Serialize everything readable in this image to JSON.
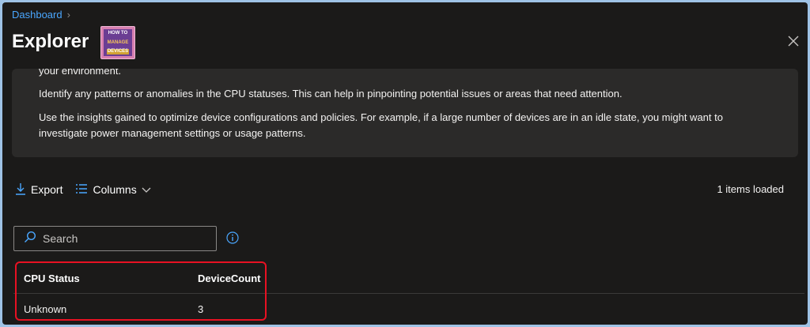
{
  "breadcrumb": {
    "root": "Dashboard",
    "separator": "›"
  },
  "page_title": "Explorer",
  "logo": {
    "line1": "HOW TO",
    "line2": "MANAGE",
    "line3": "DEVICES"
  },
  "info": {
    "cut_line": "your environment.",
    "p1": "Identify any patterns or anomalies in the CPU statuses. This can help in pinpointing potential issues or areas that need attention.",
    "p2": "Use the insights gained to optimize device configurations and policies. For example, if a large number of devices are in an idle state, you might want to investigate power management settings or usage patterns."
  },
  "toolbar": {
    "export_label": "Export",
    "columns_label": "Columns"
  },
  "status": {
    "items_loaded": "1 items loaded"
  },
  "search": {
    "placeholder": "Search",
    "value": ""
  },
  "table": {
    "headers": [
      "CPU Status",
      "DeviceCount"
    ],
    "rows": [
      [
        "Unknown",
        "3"
      ]
    ]
  },
  "colors": {
    "accent": "#4aa7ff",
    "highlight": "#e81123",
    "background": "#1b1a19",
    "panel": "#2b2a29"
  },
  "icons": [
    "chevron-right-icon",
    "close-icon",
    "download-icon",
    "columns-icon",
    "chevron-down-icon",
    "search-icon",
    "info-icon"
  ]
}
